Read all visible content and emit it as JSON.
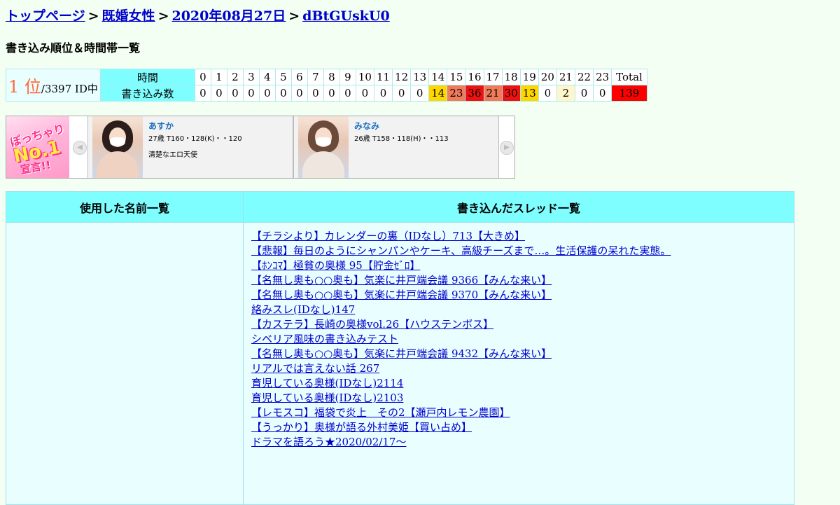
{
  "breadcrumb": {
    "items": [
      "トップページ",
      "既婚女性",
      "2020年08月27日",
      "dBtGUskU0"
    ],
    "separator": ">"
  },
  "section_title": "書き込み順位＆時間帯一覧",
  "rank": {
    "position": "1 位",
    "total": "/3397 ID中"
  },
  "hours_table": {
    "time_label": "時間",
    "count_label": "書き込み数",
    "total_label": "Total",
    "hours": [
      "0",
      "1",
      "2",
      "3",
      "4",
      "5",
      "6",
      "7",
      "8",
      "9",
      "10",
      "11",
      "12",
      "13",
      "14",
      "15",
      "16",
      "17",
      "18",
      "19",
      "20",
      "21",
      "22",
      "23"
    ],
    "counts": [
      "0",
      "0",
      "0",
      "0",
      "0",
      "0",
      "0",
      "0",
      "0",
      "0",
      "0",
      "0",
      "0",
      "0",
      "14",
      "23",
      "36",
      "21",
      "30",
      "13",
      "0",
      "2",
      "0",
      "0"
    ],
    "total": "139",
    "heat_colors": {
      "0": "#ffffff",
      "2": "#fff6cc",
      "13": "#ffd700",
      "14": "#ffd700",
      "21": "#ef7b5a",
      "23": "#ef7b5a",
      "30": "#ee1111",
      "36": "#ee1111",
      "139": "#ff0000"
    }
  },
  "ad": {
    "logo_line1": "ぽっちゃり",
    "logo_line2": "No.1",
    "logo_line3": "宣言!!",
    "profiles": [
      {
        "name": "あすか",
        "stats": "27歳 T160・128(K)・・120",
        "comment": "清楚なエロ天使"
      },
      {
        "name": "みなみ",
        "stats": "26歳 T158・118(H)・・113",
        "comment": ""
      }
    ]
  },
  "lists_table": {
    "names_header": "使用した名前一覧",
    "threads_header": "書き込んだスレッド一覧",
    "names": [],
    "threads": [
      "【チラシより】カレンダーの裏（IDなし）713【大きめ】",
      "【悲報】毎日のようにシャンパンやケーキ、高級チーズまで…。生活保護の呆れた実態。",
      "【ﾎﾝｺﾏ】極貧の奥様 95【貯金ｾﾞﾛ】",
      "【名無し奥も○○奥も】気楽に井戸端会議 9366【みんな来い】",
      "【名無し奥も○○奥も】気楽に井戸端会議 9370【みんな来い】",
      "絡みスレ(IDなし)147",
      "【カステラ】長崎の奥様vol.26【ハウステンボス】",
      "シベリア風味の書き込みテスト",
      "【名無し奥も○○奥も】気楽に井戸端会議 9432【みんな来い】",
      "リアルでは言えない話 267",
      "育児している奥様(IDなし)2114",
      "育児している奥様(IDなし)2103",
      "【レモスコ】福袋で炎上　その2【瀬戸内レモン農園】",
      "【うっかり】奥様が語る外村美姫【買い占め】",
      "ドラマを語ろう★2020/02/17～"
    ]
  }
}
